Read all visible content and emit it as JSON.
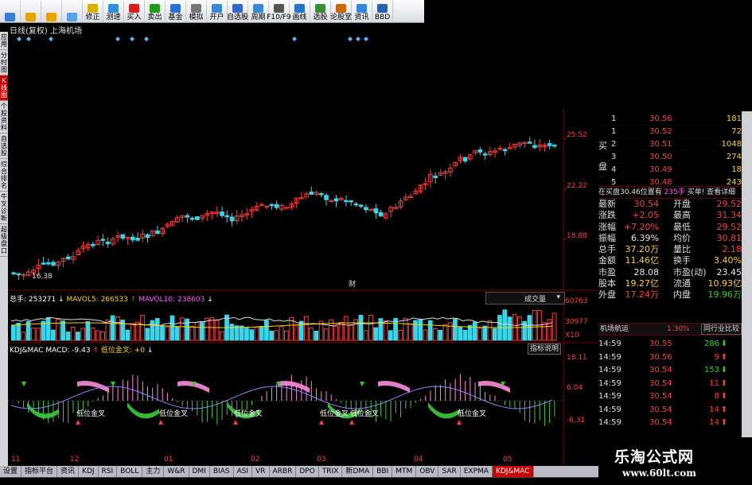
{
  "toolbar": {
    "items": [
      {
        "label": "",
        "icon": "grid-icon",
        "color": "#3a7bd5"
      },
      {
        "label": "",
        "icon": "back-arrow-icon",
        "color": "#e8a400"
      },
      {
        "label": "",
        "icon": "forward-arrow-icon",
        "color": "#e8a400"
      },
      {
        "label": "",
        "icon": "refresh-icon",
        "color": "#5aa0e6"
      },
      {
        "label": "修正",
        "icon": "edit-icon",
        "color": "#d8b100"
      },
      {
        "label": "测速",
        "icon": "speed-icon",
        "color": "#2d8fde"
      },
      {
        "label": "买入",
        "icon": "buy-icon",
        "color": "#d81e1e"
      },
      {
        "label": "卖出",
        "icon": "sell-icon",
        "color": "#1e9a1e"
      },
      {
        "label": "基金",
        "icon": "fund-icon",
        "color": "#2d6fd6"
      },
      {
        "label": "模拟",
        "icon": "simulate-icon",
        "color": "#777"
      },
      {
        "label": "开户",
        "icon": "account-icon",
        "color": "#3c86d8"
      },
      {
        "label": "自选股",
        "icon": "watchlist-icon",
        "color": "#3366cc"
      },
      {
        "label": "周期",
        "icon": "period-icon",
        "color": "#3a8ad8"
      },
      {
        "label": "F10/F9",
        "icon": "f10-icon",
        "color": "#555"
      },
      {
        "label": "画线",
        "icon": "draw-line-icon",
        "color": "#2277cc"
      },
      {
        "label": "选股",
        "icon": "stock-picker-icon",
        "color": "#3a8a3a"
      },
      {
        "label": "论股堂",
        "icon": "forum-icon",
        "color": "#cc6600"
      },
      {
        "label": "资讯",
        "icon": "news-icon",
        "color": "#3388dd"
      },
      {
        "label": "BBD",
        "icon": "bbd-icon",
        "color": "#2a5fb0"
      }
    ]
  },
  "chart_header": {
    "title": "日线(复权) 上海机场"
  },
  "left_tabs": [
    {
      "label": "应用"
    },
    {
      "label": "分时图"
    },
    {
      "label": "K线图",
      "active": true
    },
    {
      "label": "个股资料"
    },
    {
      "label": "自选股"
    },
    {
      "label": "综合排名"
    },
    {
      "label": "牛叉诊断"
    },
    {
      "label": "超级盘口"
    }
  ],
  "price_axis": {
    "labels": [
      "25.52",
      "22.22",
      "18.88"
    ]
  },
  "price_annotations": {
    "low_label": "16.38",
    "cai_marker": "财"
  },
  "volume_panel": {
    "header": [
      "总手: 253271",
      "MAVOL5: 266533",
      "MAVOL10: 238603"
    ],
    "header_colors": [
      "#ffffff",
      "#ffd400",
      "#ff55ff"
    ],
    "dropdown": "成交量",
    "axis_labels": [
      "60763",
      "30977",
      "X10"
    ]
  },
  "kdj_panel": {
    "header": [
      "KDJ&MAC MACD: -9.43",
      "低位金叉: +0"
    ],
    "help_button": "指标说明",
    "axis_labels": [
      "18.11",
      "6.04",
      "-6.31"
    ],
    "annotation": "低位金叉"
  },
  "date_axis": {
    "labels": [
      "11",
      "12",
      "01",
      "02",
      "03",
      "04",
      "05"
    ]
  },
  "bottom_tabs": [
    {
      "label": "设置"
    },
    {
      "label": "指标平台"
    },
    {
      "label": "资讯"
    },
    {
      "label": "KDJ"
    },
    {
      "label": "RSI"
    },
    {
      "label": "BOLL"
    },
    {
      "label": "主力"
    },
    {
      "label": "W&R"
    },
    {
      "label": "DMI"
    },
    {
      "label": "BIAS"
    },
    {
      "label": "ASI"
    },
    {
      "label": "VR"
    },
    {
      "label": "ARBR"
    },
    {
      "label": "DPO"
    },
    {
      "label": "TRIX"
    },
    {
      "label": "新DMA"
    },
    {
      "label": "BBI"
    },
    {
      "label": "MTM"
    },
    {
      "label": "OBV"
    },
    {
      "label": "SAR"
    },
    {
      "label": "EXPMA"
    },
    {
      "label": "KDJ&MAC",
      "active": true
    }
  ],
  "order_book": {
    "side_label": "买盘",
    "rows": [
      {
        "level": "1",
        "price": "30.56",
        "volume": "181"
      },
      {
        "level": "1",
        "price": "30.52",
        "volume": "72"
      },
      {
        "level": "2",
        "price": "30.51",
        "volume": "1048"
      },
      {
        "level": "3",
        "price": "30.50",
        "volume": "274"
      },
      {
        "level": "4",
        "price": "30.49",
        "volume": "18"
      },
      {
        "level": "5",
        "price": "30.48",
        "volume": "243"
      }
    ],
    "summary": {
      "left": "在买盘30.46位置有",
      "count": "235手",
      "right": "买单! 查看详细"
    }
  },
  "quotes": [
    {
      "k1": "最新",
      "v1": "30.54",
      "c1": "#ff3b3b",
      "k2": "开盘",
      "v2": "29.52",
      "c2": "#ff3b3b"
    },
    {
      "k1": "涨跌",
      "v1": "+2.05",
      "c1": "#ff3b3b",
      "k2": "最高",
      "v2": "31.34",
      "c2": "#ff3b3b"
    },
    {
      "k1": "涨幅",
      "v1": "+7.20%",
      "c1": "#ff3b3b",
      "k2": "最低",
      "v2": "29.52",
      "c2": "#ff3b3b"
    },
    {
      "k1": "振幅",
      "v1": "6.39%",
      "c1": "#e8e8e8",
      "k2": "均价",
      "v2": "30.81",
      "c2": "#ff3b3b"
    },
    {
      "k1": "总手",
      "v1": "37.20万",
      "c1": "#ffd400",
      "k2": "量比",
      "v2": "2.18",
      "c2": "#ff3b3b"
    },
    {
      "k1": "金额",
      "v1": "11.46亿",
      "c1": "#ffd400",
      "k2": "换手",
      "v2": "3.40%",
      "c2": "#ffd400"
    },
    {
      "k1": "市盈",
      "v1": "28.08",
      "c1": "#e8e8e8",
      "k2": "市盈(动)",
      "v2": "23.45",
      "c2": "#e8e8e8"
    },
    {
      "k1": "股本",
      "v1": "19.27亿",
      "c1": "#ffd400",
      "k2": "流通",
      "v2": "10.93亿",
      "c2": "#ffd400"
    },
    {
      "k1": "外盘",
      "v1": "17.24万",
      "c1": "#ff3b3b",
      "k2": "内盘",
      "v2": "19.96万",
      "c2": "#22d322"
    }
  ],
  "sector_bar": {
    "name": "机场航运",
    "change": "1.30%",
    "link": "同行业比较"
  },
  "trades": [
    {
      "time": "14:59",
      "price": "30.55",
      "vol": "286",
      "dir": "down"
    },
    {
      "time": "14:59",
      "price": "30.56",
      "vol": "9",
      "dir": "up"
    },
    {
      "time": "14:59",
      "price": "30.54",
      "vol": "153",
      "dir": "down"
    },
    {
      "time": "14:59",
      "price": "30.54",
      "vol": "11",
      "dir": "up"
    },
    {
      "time": "14:59",
      "price": "30.54",
      "vol": "8",
      "dir": "up"
    },
    {
      "time": "14:59",
      "price": "30.54",
      "vol": "14",
      "dir": "up"
    },
    {
      "time": "14:59",
      "price": "30.54",
      "vol": "14",
      "dir": "up"
    }
  ],
  "watermark": {
    "title": "乐淘公式网",
    "url": "www.60lt.com"
  },
  "colors": {
    "up": "#ff3b3b",
    "down": "#37d6e8",
    "macd_up": "#ff8ad8",
    "macd_down": "#3ccc3c"
  }
}
